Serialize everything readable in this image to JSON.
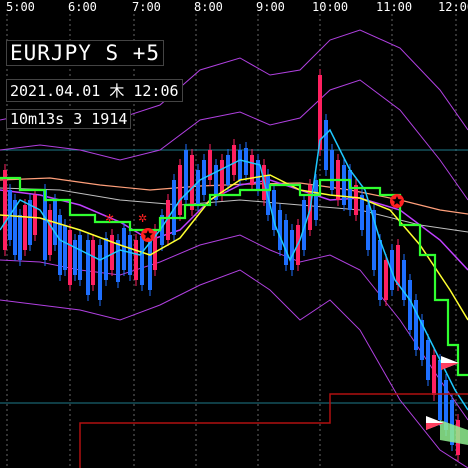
{
  "time_axis": {
    "labels": [
      "5:00",
      "6:00",
      "7:00",
      "8:00",
      "9:00",
      "10:00",
      "11:00",
      "12:00"
    ]
  },
  "info": {
    "symbol": "EURJPY S +5",
    "datetime": "2021.04.01 木 12:06",
    "counter": "10m13s 3 1914"
  },
  "colors": {
    "background": "#000000",
    "bull_candle": "#ff2060",
    "bear_candle": "#1e6fff",
    "ma_fast": "#1ec8ff",
    "ma_mid": "#ffff30",
    "ma_slow_purple": "#c040ff",
    "ma_salmon": "#ff9f7a",
    "step_line_green": "#30ff30",
    "step_line_red": "#b01010",
    "bollinger_band": "#b040e0",
    "grid_horizontal": "#1e7a8a",
    "grid_vertical": "#666666",
    "signal_marker": "#ff2020"
  },
  "markers": [
    {
      "icon": "star-signal-icon"
    },
    {
      "icon": "star-signal-icon"
    }
  ],
  "arrows": [
    {
      "icon": "sell-arrow-icon"
    },
    {
      "icon": "sell-arrow-icon"
    }
  ]
}
